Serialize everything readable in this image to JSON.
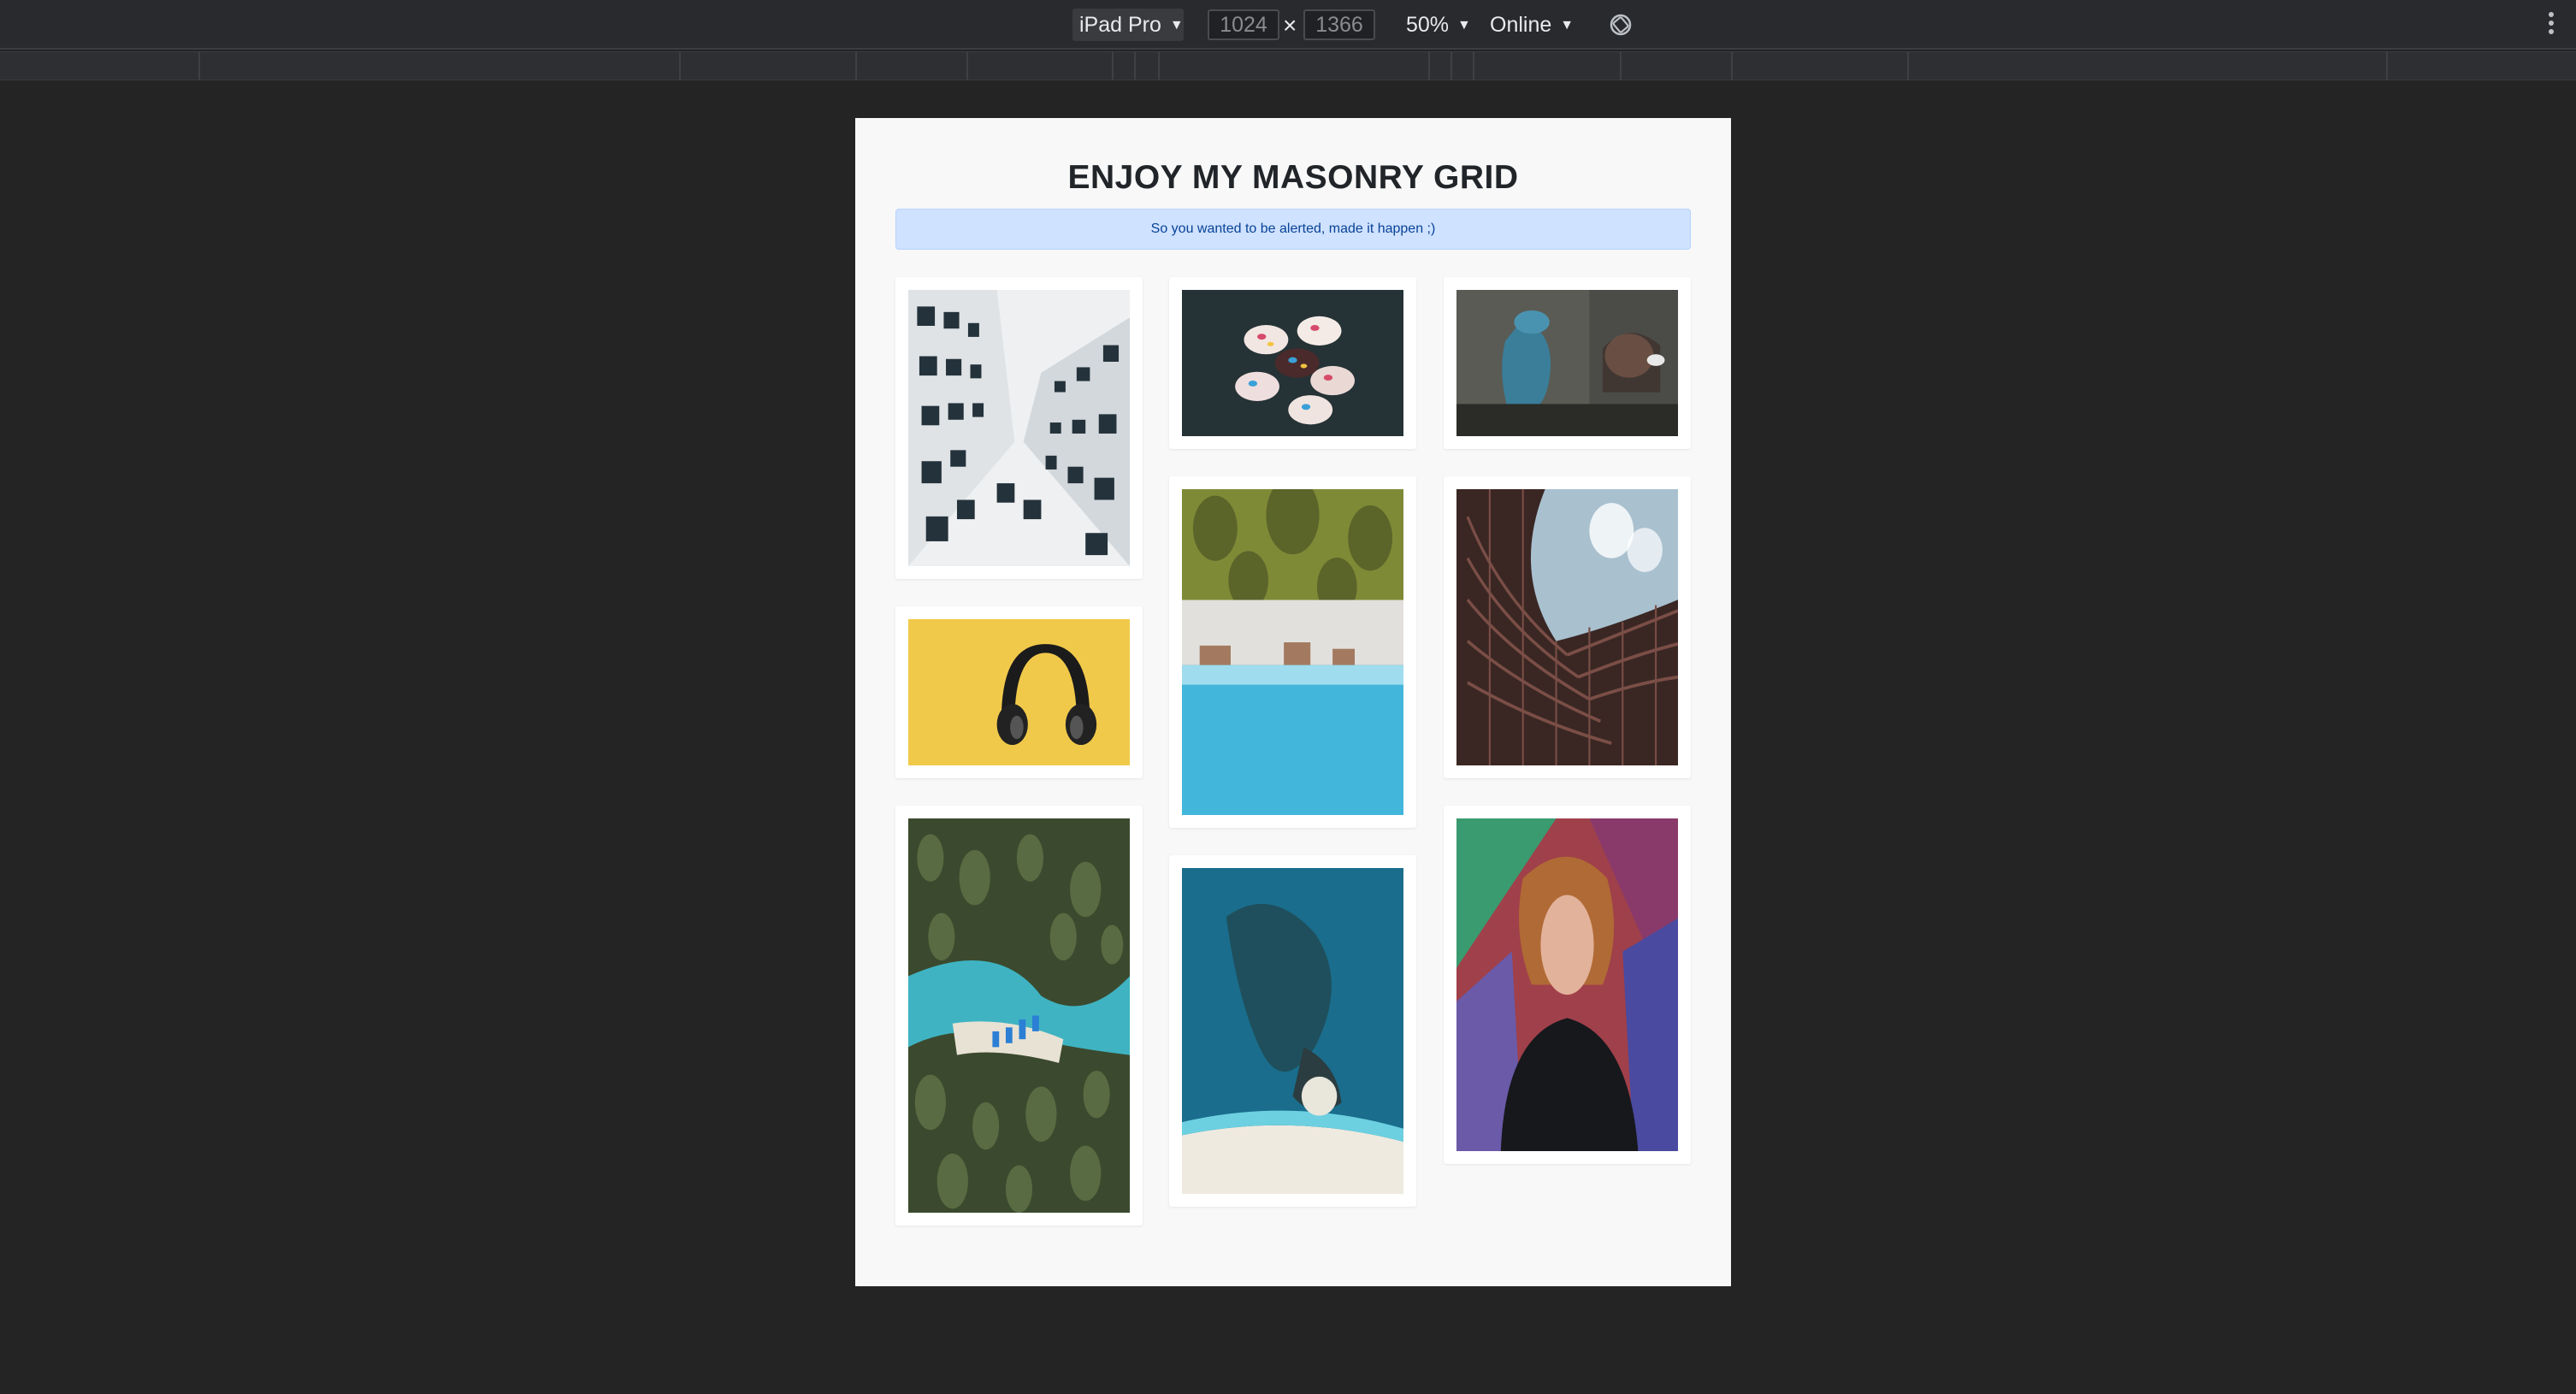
{
  "toolbar": {
    "device": "iPad Pro",
    "width": "1024",
    "height": "1366",
    "times": "×",
    "zoom": "50%",
    "network": "Online",
    "rotate_icon": "rotate-icon",
    "menu_icon": "more-vertical-icon"
  },
  "page": {
    "title": "ENJOY MY MASONRY GRID",
    "alert": "So you wanted to be alerted, made it happen ;)",
    "colors": {
      "alert_bg": "#cfe2ff",
      "alert_text": "#084298",
      "page_bg": "#f8f8f8"
    }
  },
  "gallery": {
    "images": [
      {
        "id": "building-facade",
        "subject": "looking up between white buildings"
      },
      {
        "id": "headphones",
        "subject": "black headphones on yellow background"
      },
      {
        "id": "palm-coast",
        "subject": "aerial view of palm trees and turquoise water"
      },
      {
        "id": "cupcakes",
        "subject": "cupcakes with sprinkles on dark surface"
      },
      {
        "id": "beach-palms",
        "subject": "palm trees above a sandy beach and sea"
      },
      {
        "id": "coral-reef",
        "subject": "aerial view of a reef and beach"
      },
      {
        "id": "graffiti-girl",
        "subject": "person with headphones beside graffiti"
      },
      {
        "id": "curved-tower",
        "subject": "curved modern tower against sky"
      },
      {
        "id": "portrait-mural",
        "subject": "curly-haired person in front of a mural"
      }
    ]
  }
}
